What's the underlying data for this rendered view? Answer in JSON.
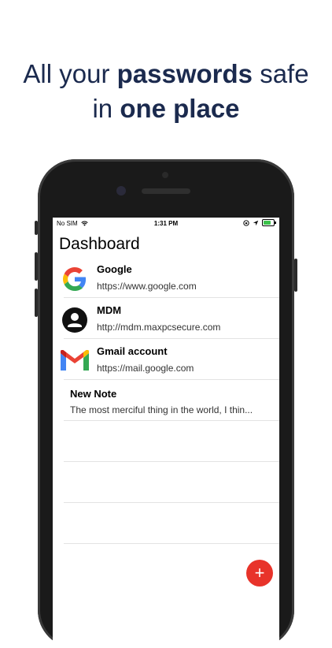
{
  "headline": {
    "line1_pre": "All your ",
    "line1_bold": "passwords",
    "line1_post": " safe",
    "line2_pre": "in ",
    "line2_bold": "one place"
  },
  "status_bar": {
    "carrier": "No SIM",
    "time": "1:31 PM"
  },
  "dashboard": {
    "title": "Dashboard",
    "items": [
      {
        "name": "Google",
        "url": "https://www.google.com",
        "icon": "google-logo-icon"
      },
      {
        "name": "MDM",
        "url": "http://mdm.maxpcsecure.com",
        "icon": "user-avatar-icon"
      },
      {
        "name": "Gmail account",
        "url": "https://mail.google.com",
        "icon": "gmail-logo-icon"
      }
    ],
    "note": {
      "title": "New Note",
      "body": "The most merciful thing in the world, I thin..."
    },
    "add_button_label": "+"
  },
  "colors": {
    "headline": "#1b2a4e",
    "fab": "#e8332a"
  }
}
